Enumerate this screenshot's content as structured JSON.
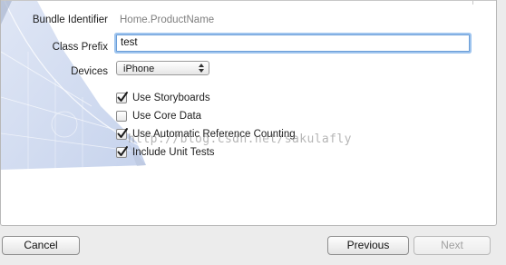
{
  "form": {
    "bundle_identifier_label": "Bundle Identifier",
    "bundle_identifier_value": "Home.ProductName",
    "class_prefix_label": "Class Prefix",
    "class_prefix_value": "test",
    "devices_label": "Devices",
    "devices_selected": "iPhone",
    "options": [
      {
        "label": "Use Storyboards",
        "checked": true
      },
      {
        "label": "Use Core Data",
        "checked": false
      },
      {
        "label": "Use Automatic Reference Counting",
        "checked": true
      },
      {
        "label": "Include Unit Tests",
        "checked": true
      }
    ]
  },
  "watermark": "http://blog.csdn.net/sakulafly",
  "footer": {
    "cancel_label": "Cancel",
    "previous_label": "Previous",
    "next_label": "Next",
    "next_enabled": false
  },
  "colors": {
    "focus_ring": "#9ec4ee",
    "blueprint": "#c9d6ef"
  }
}
